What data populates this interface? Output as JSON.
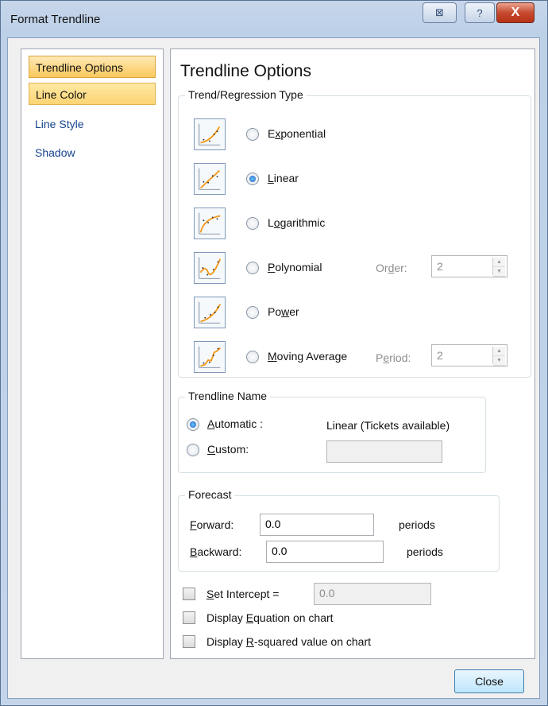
{
  "window": {
    "title": "Format Trendline",
    "help_glyph": "?",
    "close_glyph": "X",
    "restore_glyph": "⊠"
  },
  "nav": {
    "items": [
      {
        "label": "Trendline Options",
        "state": "selected"
      },
      {
        "label": "Line Color",
        "state": "hover"
      },
      {
        "label": "Line Style",
        "state": "normal"
      },
      {
        "label": "Shadow",
        "state": "normal"
      }
    ]
  },
  "panel": {
    "heading": "Trendline Options",
    "regression_group_label": "Trend/Regression Type",
    "types": [
      {
        "pre": "E",
        "acc": "x",
        "post": "ponential",
        "icon": "exponential-icon",
        "selected": false
      },
      {
        "pre": "",
        "acc": "L",
        "post": "inear",
        "icon": "linear-icon",
        "selected": true
      },
      {
        "pre": "L",
        "acc": "o",
        "post": "garithmic",
        "icon": "logarithmic-icon",
        "selected": false
      },
      {
        "pre": "",
        "acc": "P",
        "post": "olynomial",
        "icon": "polynomial-icon",
        "selected": false
      },
      {
        "pre": "Po",
        "acc": "w",
        "post": "er",
        "icon": "power-icon",
        "selected": false
      },
      {
        "pre": "",
        "acc": "M",
        "post": "oving Average",
        "icon": "moving-average-icon",
        "selected": false
      }
    ],
    "order": {
      "pre": "Or",
      "acc": "d",
      "post": "er:",
      "value": "2"
    },
    "period": {
      "pre": "P",
      "acc": "e",
      "post": "riod:",
      "value": "2"
    },
    "name_group_label": "Trendline Name",
    "automatic": {
      "pre": "",
      "acc": "A",
      "post": "utomatic :",
      "selected": true,
      "value": "Linear (Tickets available)"
    },
    "custom": {
      "pre": "",
      "acc": "C",
      "post": "ustom:",
      "selected": false,
      "value": ""
    },
    "forecast_group_label": "Forecast",
    "forward": {
      "pre": "",
      "acc": "F",
      "post": "orward:",
      "value": "0.0",
      "unit": "periods"
    },
    "backward": {
      "pre": "",
      "acc": "B",
      "post": "ackward:",
      "value": "0.0",
      "unit": "periods"
    },
    "set_intercept": {
      "pre": "",
      "acc": "S",
      "post": "et Intercept =",
      "checked": false,
      "value": "0.0"
    },
    "display_equation": {
      "pre": "Display ",
      "acc": "E",
      "post": "quation on chart",
      "checked": false
    },
    "display_rsquared": {
      "pre": "Display ",
      "acc": "R",
      "post": "-squared value on chart",
      "checked": false
    }
  },
  "footer": {
    "close_label": "Close"
  },
  "colors": {
    "accent": "#f6a423",
    "nav_text": "#15428b",
    "selected_nav": "#fcc95d"
  }
}
